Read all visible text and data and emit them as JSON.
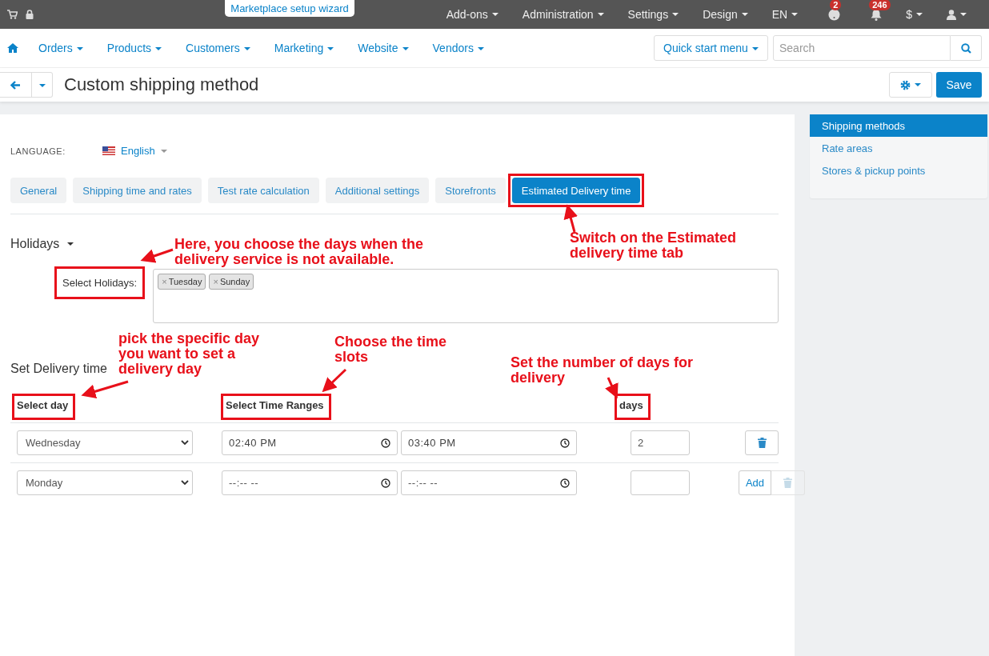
{
  "top_bar": {
    "wizard_tab": "Marketplace setup wizard",
    "menus": [
      "Add-ons",
      "Administration",
      "Settings",
      "Design",
      "EN"
    ],
    "help_badge": "2",
    "notifications_badge": "246",
    "currency": "$"
  },
  "nav": {
    "items": [
      "Orders",
      "Products",
      "Customers",
      "Marketing",
      "Website",
      "Vendors"
    ],
    "quick_start": "Quick start menu",
    "search": {
      "placeholder": "Search"
    }
  },
  "page": {
    "title": "Custom shipping method",
    "save_button": "Save"
  },
  "language": {
    "label": "LANGUAGE:",
    "value": "English"
  },
  "tabs": [
    {
      "label": "General",
      "selected": false,
      "highlighted": false
    },
    {
      "label": "Shipping time and rates",
      "selected": false,
      "highlighted": false
    },
    {
      "label": "Test rate calculation",
      "selected": false,
      "highlighted": false
    },
    {
      "label": "Additional settings",
      "selected": false,
      "highlighted": false
    },
    {
      "label": "Storefronts",
      "selected": false,
      "highlighted": false
    },
    {
      "label": "Estimated Delivery time",
      "selected": true,
      "highlighted": true
    }
  ],
  "holidays": {
    "heading": "Holidays",
    "label": "Select Holidays:",
    "label_highlighted": true,
    "tags": [
      {
        "label": "Tuesday",
        "remove": "×"
      },
      {
        "label": "Sunday",
        "remove": "×"
      }
    ]
  },
  "delivery": {
    "heading": "Set Delivery time",
    "columns": [
      {
        "label": "Select day",
        "highlighted": true
      },
      {
        "label": "Select Time Ranges",
        "highlighted": true
      },
      {
        "label": "days",
        "highlighted": true
      }
    ],
    "rows": [
      {
        "day": "Wednesday",
        "start": {
          "value": "02:40 PM"
        },
        "end": {
          "value": "03:40 PM"
        },
        "days": {
          "value": "2"
        },
        "actions": [
          {
            "kind": "delete",
            "disabled": false
          }
        ]
      },
      {
        "day": "Monday",
        "start": {
          "placeholder": "--:-- --"
        },
        "end": {
          "placeholder": "--:-- --"
        },
        "days": {},
        "actions": [
          {
            "kind": "add",
            "label": "Add"
          },
          {
            "kind": "delete",
            "disabled": true
          }
        ]
      }
    ]
  },
  "sidebar": {
    "items": [
      {
        "label": "Shipping methods",
        "selected": true
      },
      {
        "label": "Rate areas",
        "selected": false
      },
      {
        "label": "Stores & pickup points",
        "selected": false
      }
    ]
  },
  "annotations": [
    {
      "text": "Here, you choose the days when the delivery service is not available."
    },
    {
      "text": "Switch on the Estimated delivery time tab"
    },
    {
      "text": "pick the specific day you want to set a delivery day"
    },
    {
      "text": "Choose the time slots"
    },
    {
      "text": "Set the number of days for delivery"
    }
  ]
}
